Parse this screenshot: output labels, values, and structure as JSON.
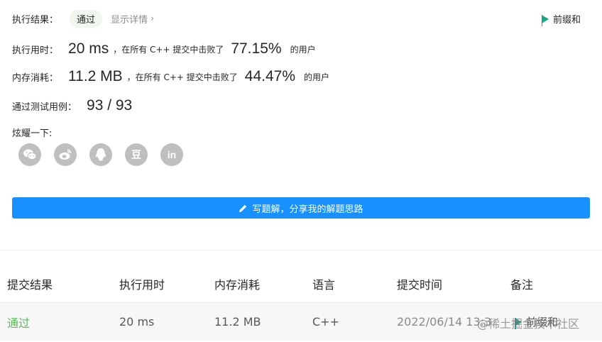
{
  "result": {
    "label": "执行结果：",
    "status": "通过",
    "details_link": "显示详情",
    "chevron": "›",
    "tag_link": "前缀和"
  },
  "runtime": {
    "label": "执行用时：",
    "value": "20 ms",
    "mid_text": "，在所有 C++ 提交中击败了",
    "percent": "77.15%",
    "suffix": "的用户"
  },
  "memory": {
    "label": "内存消耗：",
    "value": "11.2 MB",
    "mid_text": "，在所有 C++ 提交中击败了",
    "percent": "44.47%",
    "suffix": "的用户"
  },
  "tests": {
    "label": "通过测试用例：",
    "value": "93 / 93"
  },
  "share": {
    "label": "炫耀一下:",
    "icons": [
      "wechat-icon",
      "weibo-icon",
      "qq-icon",
      "douban-icon",
      "linkedin-icon"
    ],
    "douban_glyph": "豆",
    "linkedin_glyph": "in"
  },
  "write_button": {
    "label": "写题解，分享我的解题思路",
    "icon": "pencil-icon"
  },
  "table": {
    "headers": [
      "提交结果",
      "执行用时",
      "内存消耗",
      "语言",
      "提交时间",
      "备注"
    ],
    "rows": [
      {
        "status": "通过",
        "runtime": "20 ms",
        "memory": "11.2 MB",
        "language": "C++",
        "time": "2022/06/14 13:3",
        "note": "前缀和"
      }
    ]
  },
  "watermark": "@稀土掘金技术社区",
  "colors": {
    "accent_blue": "#1890ff",
    "success_green": "#5cb85c",
    "flag_teal": "#1ba784",
    "icon_gray": "#bfbfbf"
  }
}
